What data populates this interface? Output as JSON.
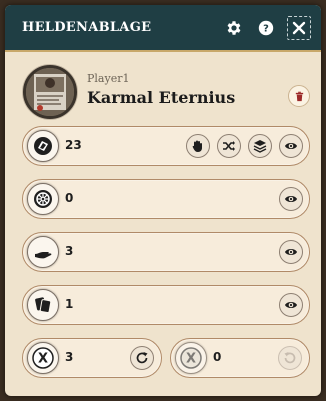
{
  "header": {
    "title": "HELDENABLAGE",
    "icons": [
      "gear-icon",
      "help-icon",
      "close-icon"
    ]
  },
  "player": {
    "label": "Player1",
    "name": "Karmal Eternius"
  },
  "piles": [
    {
      "name": "deck",
      "count": "23",
      "icon": "deck-icon",
      "actions": [
        "hand-icon",
        "shuffle-icon",
        "layers-icon",
        "eye-icon"
      ]
    },
    {
      "name": "discard",
      "count": "0",
      "icon": "wheel-icon",
      "actions": [
        "eye-icon"
      ]
    },
    {
      "name": "hand",
      "count": "3",
      "icon": "open-hand-icon",
      "actions": [
        "eye-icon"
      ]
    },
    {
      "name": "cards",
      "count": "1",
      "icon": "cards-icon",
      "actions": [
        "eye-icon"
      ]
    }
  ],
  "tokens": [
    {
      "name": "exhaust-token-active",
      "count": "3",
      "icon": "x-token-icon",
      "action": "reset-icon"
    },
    {
      "name": "exhaust-token-used",
      "count": "0",
      "icon": "x-token-icon",
      "action": "reset-icon"
    }
  ],
  "colors": {
    "titlebar": "#1f3e44",
    "panel": "#efe3cd",
    "row": "#f7ecdb",
    "border": "#b08a68",
    "delete": "#9c2a2a"
  }
}
